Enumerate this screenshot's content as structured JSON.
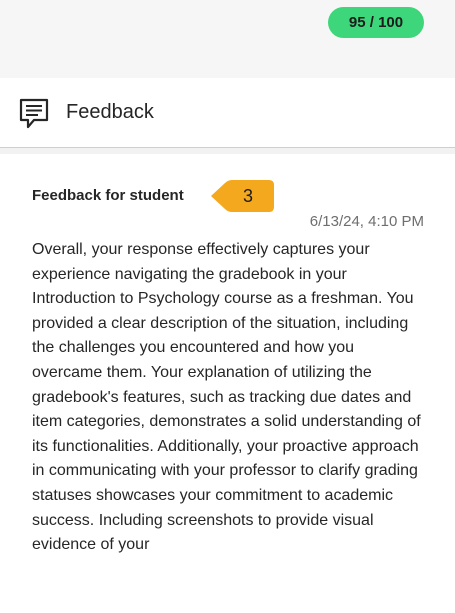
{
  "grade": {
    "label": "95 / 100",
    "score": 95,
    "max": 100,
    "color": "#3ed67a"
  },
  "panel": {
    "title": "Feedback",
    "icon": "feedback-comment-icon"
  },
  "feedback": {
    "label": "Feedback for student",
    "callout_number": "3",
    "callout_color": "#f4a81d",
    "timestamp": "6/13/24, 4:10 PM",
    "text": "Overall, your response effectively captures your experience navigating the gradebook in your Introduction to Psychology course as a freshman. You provided a clear description of the situation, including the challenges you encountered and how you overcame them. Your explanation of utilizing the gradebook's features, such as tracking due dates and item categories, demonstrates a solid understanding of its functionalities. Additionally, your proactive approach in communicating with your professor to clarify grading statuses showcases your commitment to academic success. Including screenshots to provide visual evidence of your"
  }
}
